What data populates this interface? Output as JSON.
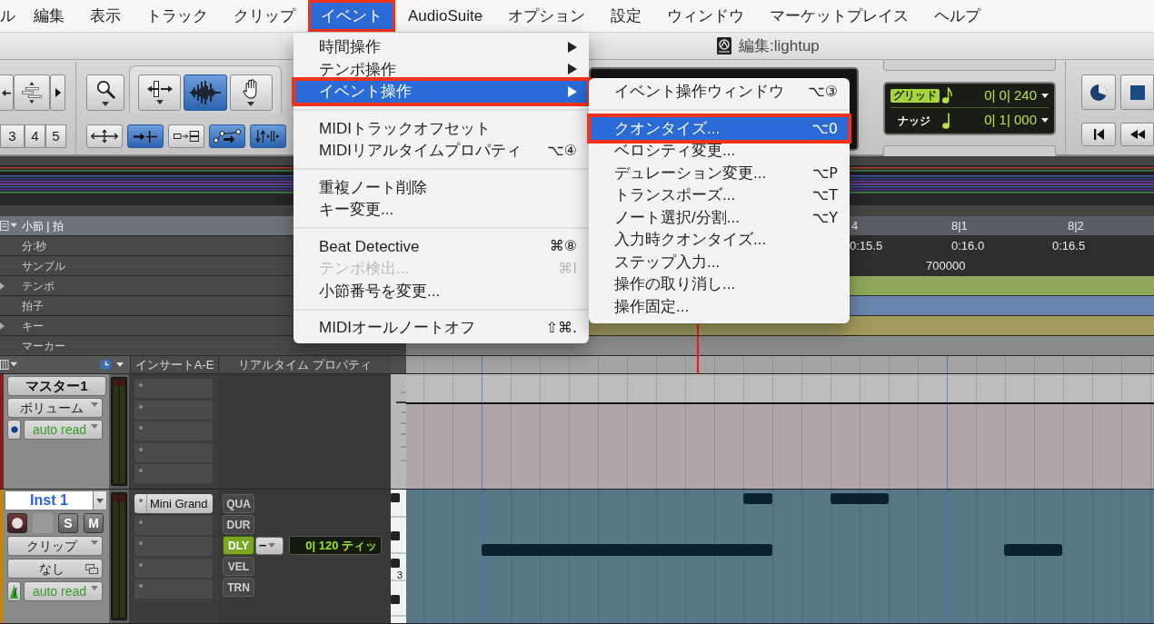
{
  "menu_bar": {
    "items": [
      {
        "label": "ル",
        "selected": false,
        "outlined": false
      },
      {
        "label": "編集",
        "selected": false,
        "outlined": false
      },
      {
        "label": "表示",
        "selected": false,
        "outlined": false
      },
      {
        "label": "トラック",
        "selected": false,
        "outlined": false
      },
      {
        "label": "クリップ",
        "selected": false,
        "outlined": false
      },
      {
        "label": "イベント",
        "selected": true,
        "outlined": true
      },
      {
        "label": "AudioSuite",
        "selected": false,
        "outlined": false
      },
      {
        "label": "オプション",
        "selected": false,
        "outlined": false
      },
      {
        "label": "設定",
        "selected": false,
        "outlined": false
      },
      {
        "label": "ウィンドウ",
        "selected": false,
        "outlined": false
      },
      {
        "label": "マーケットプレイス",
        "selected": false,
        "outlined": false
      },
      {
        "label": "ヘルプ",
        "selected": false,
        "outlined": false
      }
    ]
  },
  "window": {
    "title": "編集:lightup"
  },
  "toolbar": {
    "zoom_presets": [
      "3",
      "4",
      "5"
    ],
    "edit_tools": [
      {
        "kind": "zoomer",
        "selected": false
      },
      {
        "kind": "trimmer",
        "selected": false
      },
      {
        "kind": "selector",
        "selected": true
      },
      {
        "kind": "grabber",
        "selected": false
      }
    ],
    "edit_options": [
      {
        "kind": "spread-arrows",
        "selected": false
      },
      {
        "kind": "insert-arrow",
        "selected": true
      },
      {
        "kind": "box-arrow",
        "selected": false
      },
      {
        "kind": "node-arrow",
        "selected": true
      },
      {
        "kind": "updown-bars",
        "selected": true
      }
    ],
    "grid": {
      "label": "グリッド",
      "value": "0| 0| 240"
    },
    "nudge": {
      "label": "ナッジ",
      "value": "0| 1| 000"
    }
  },
  "rulers": [
    {
      "label": "小節 | 拍",
      "selected": true,
      "expandable": false,
      "color": "#5a5d64",
      "marks": [
        "4",
        "8|1",
        "8|2"
      ]
    },
    {
      "label": "分:秒",
      "selected": false,
      "expandable": false,
      "color": "#2e2e2e",
      "marks": [
        "0:15.5",
        "0:16.0",
        "0:16.5"
      ]
    },
    {
      "label": "サンプル",
      "selected": false,
      "expandable": false,
      "color": "#2e2e2e",
      "marks": [
        "700000"
      ]
    },
    {
      "label": "テンポ",
      "selected": false,
      "expandable": true,
      "color": "#8fa75b"
    },
    {
      "label": "拍子",
      "selected": false,
      "expandable": false,
      "color": "#6985ad"
    },
    {
      "label": "キー",
      "selected": false,
      "expandable": true,
      "color": "#a19a5e"
    },
    {
      "label": "マーカー",
      "selected": false,
      "expandable": false,
      "color": "#8b8b8b"
    }
  ],
  "track_list_header": {
    "columns": [
      "インサートA-E",
      "リアルタイム プロパティ"
    ]
  },
  "tracks": [
    {
      "kind": "master",
      "name": "マスター1",
      "color": "#7a1e1e",
      "view": "ボリューム",
      "automation": "auto read",
      "inserts": [
        {
          "kind": "empty"
        },
        {
          "kind": "empty"
        },
        {
          "kind": "empty"
        },
        {
          "kind": "empty"
        },
        {
          "kind": "empty"
        }
      ]
    },
    {
      "kind": "instrument",
      "name": "Inst 1",
      "color": "#b8861f",
      "buttons": [
        "S",
        "M"
      ],
      "view": "クリップ",
      "playlist": "なし",
      "automation": "auto read",
      "inserts": [
        {
          "kind": "plugin",
          "name": "Mini Grand"
        },
        {
          "kind": "empty"
        },
        {
          "kind": "empty"
        },
        {
          "kind": "empty"
        },
        {
          "kind": "empty"
        }
      ],
      "realtime_properties": [
        {
          "label": "QUA",
          "on": false
        },
        {
          "label": "DUR",
          "on": false
        },
        {
          "label": "DLY",
          "on": true,
          "amount": {
            "direction": "–",
            "value": "0| 120 ティッ"
          }
        },
        {
          "label": "VEL",
          "on": false
        },
        {
          "label": "TRN",
          "on": false
        }
      ],
      "octave_label": "3"
    }
  ],
  "event_menu": {
    "items": [
      {
        "kind": "item",
        "label": "時間操作",
        "submenu": true,
        "selected": false,
        "outlined": false,
        "disabled": false
      },
      {
        "kind": "item",
        "label": "テンポ操作",
        "submenu": true,
        "selected": false,
        "outlined": false,
        "disabled": false
      },
      {
        "kind": "item",
        "label": "イベント操作",
        "submenu": true,
        "selected": true,
        "outlined": true,
        "disabled": false
      },
      {
        "kind": "separator"
      },
      {
        "kind": "item",
        "label": "MIDIトラックオフセット",
        "submenu": false,
        "selected": false,
        "outlined": false,
        "disabled": false
      },
      {
        "kind": "item",
        "label": "MIDIリアルタイムプロパティ",
        "shortcut": "⌥④",
        "submenu": false,
        "selected": false,
        "outlined": false,
        "disabled": false
      },
      {
        "kind": "separator"
      },
      {
        "kind": "item",
        "label": "重複ノート削除",
        "submenu": false,
        "selected": false,
        "outlined": false,
        "disabled": false
      },
      {
        "kind": "item",
        "label": "キー変更...",
        "submenu": false,
        "selected": false,
        "outlined": false,
        "disabled": false
      },
      {
        "kind": "separator"
      },
      {
        "kind": "item",
        "label": "Beat Detective",
        "shortcut": "⌘⑧",
        "submenu": false,
        "selected": false,
        "outlined": false,
        "disabled": false
      },
      {
        "kind": "item",
        "label": "テンポ検出...",
        "shortcut": "⌘I",
        "submenu": false,
        "selected": false,
        "outlined": false,
        "disabled": true
      },
      {
        "kind": "item",
        "label": "小節番号を変更...",
        "submenu": false,
        "selected": false,
        "outlined": false,
        "disabled": false
      },
      {
        "kind": "separator"
      },
      {
        "kind": "item",
        "label": "MIDIオールノートオフ",
        "shortcut": "⇧⌘.",
        "submenu": false,
        "selected": false,
        "outlined": false,
        "disabled": false
      }
    ]
  },
  "event_submenu": {
    "items": [
      {
        "kind": "item",
        "label": "イベント操作ウィンドウ",
        "shortcut": "⌥③",
        "selected": false,
        "outlined": false
      },
      {
        "kind": "separator"
      },
      {
        "kind": "item",
        "label": "クオンタイズ...",
        "shortcut": "⌥0",
        "selected": true,
        "outlined": true
      },
      {
        "kind": "item",
        "label": "ベロシティ変更...",
        "selected": false,
        "outlined": false
      },
      {
        "kind": "item",
        "label": "デュレーション変更...",
        "shortcut": "⌥P",
        "selected": false,
        "outlined": false
      },
      {
        "kind": "item",
        "label": "トランスポーズ...",
        "shortcut": "⌥T",
        "selected": false,
        "outlined": false
      },
      {
        "kind": "item",
        "label": "ノート選択/分割...",
        "shortcut": "⌥Y",
        "selected": false,
        "outlined": false
      },
      {
        "kind": "item",
        "label": "入力時クオンタイズ...",
        "selected": false,
        "outlined": false
      },
      {
        "kind": "item",
        "label": "ステップ入力...",
        "selected": false,
        "outlined": false
      },
      {
        "kind": "item",
        "label": "操作の取り消し...",
        "selected": false,
        "outlined": false
      },
      {
        "kind": "item",
        "label": "操作固定...",
        "selected": false,
        "outlined": false
      }
    ]
  }
}
